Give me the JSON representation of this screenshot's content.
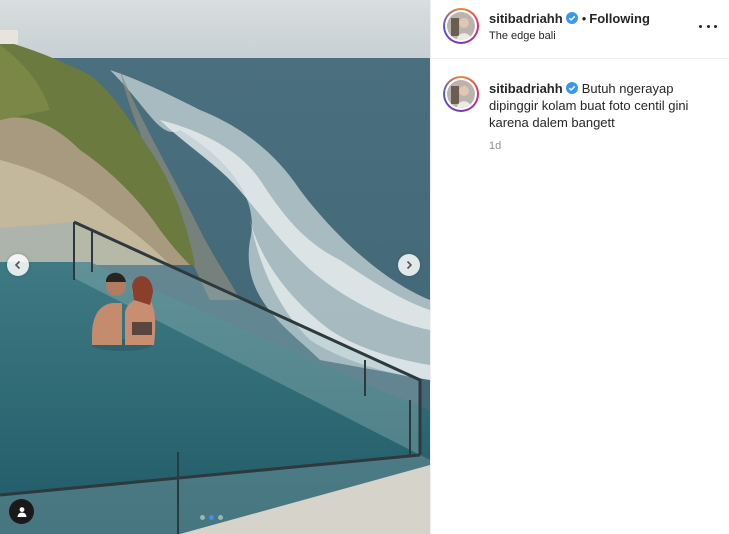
{
  "post": {
    "username": "sitibadriahh",
    "separator": "•",
    "follow_state": "Following",
    "location": "The edge bali",
    "caption": "Butuh ngerayap dipinggir kolam buat foto centil gini karena dalem bangett",
    "timestamp": "1d"
  },
  "carousel": {
    "slide_count": 3,
    "active_slide": 2
  },
  "icons": {
    "verified": "verified-badge-icon",
    "more": "more-options-icon",
    "prev": "chevron-left-icon",
    "next": "chevron-right-icon",
    "tag": "user-tag-icon"
  },
  "colors": {
    "verified": "#3897f0",
    "active_dot": "#3b8ff6",
    "timestamp": "#8e8e8e"
  }
}
